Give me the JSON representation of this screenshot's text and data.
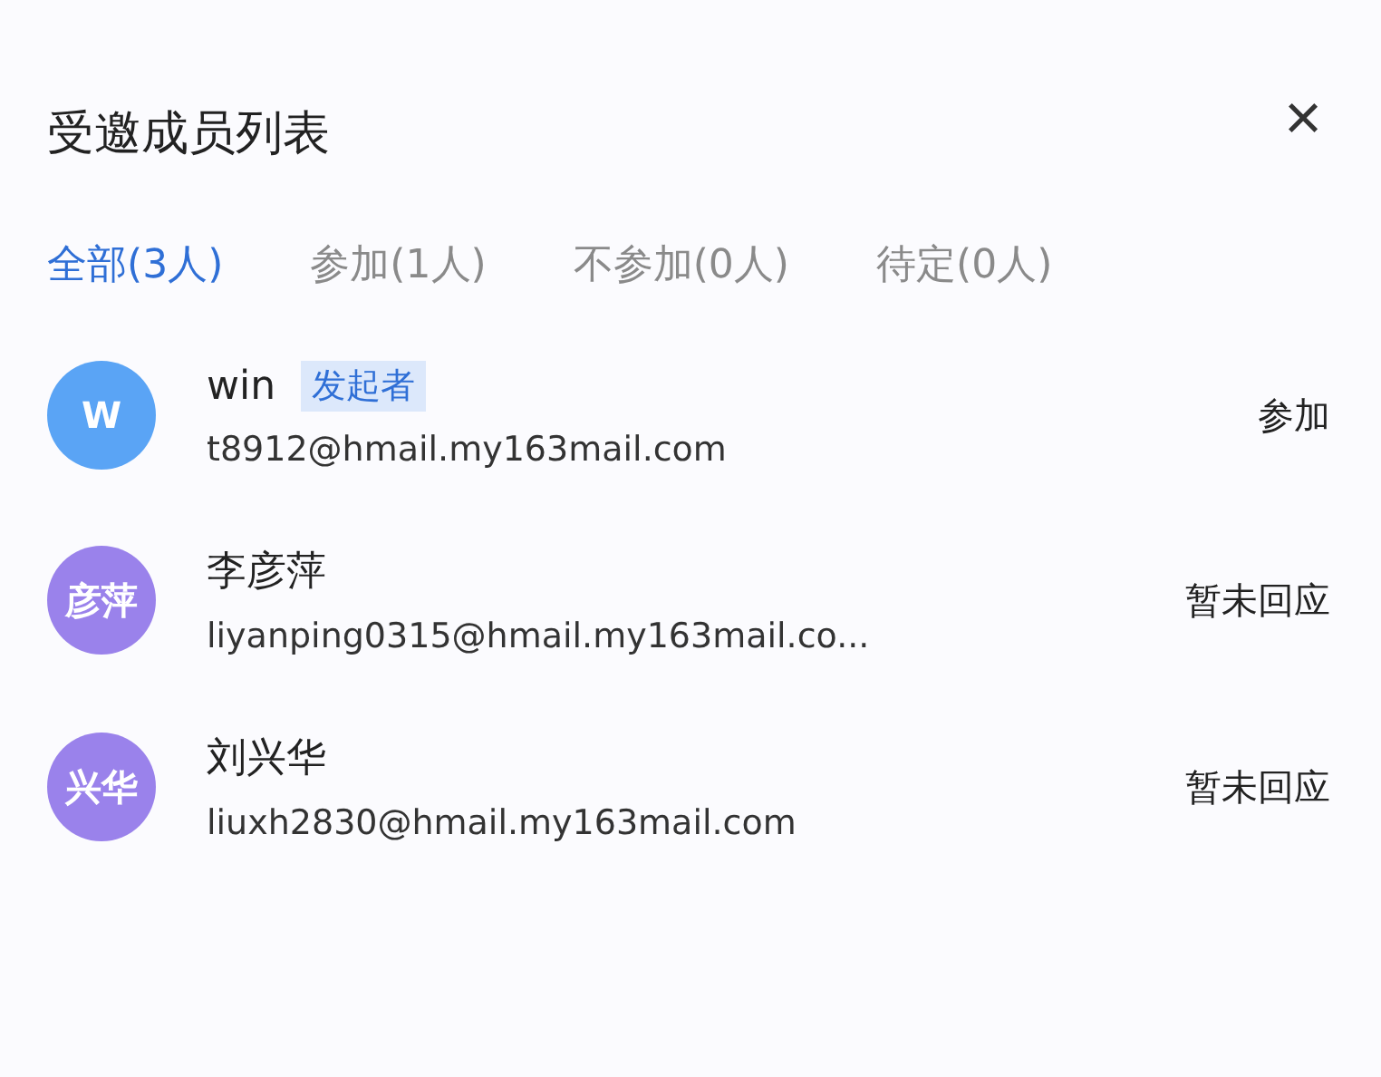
{
  "dialog": {
    "title": "受邀成员列表",
    "close": "×"
  },
  "tabs": [
    {
      "label": "全部(3人)",
      "selected": true
    },
    {
      "label": "参加(1人)",
      "selected": false
    },
    {
      "label": "不参加(0人)",
      "selected": false
    },
    {
      "label": "待定(0人)",
      "selected": false
    }
  ],
  "members": [
    {
      "avatar": "W",
      "color": "#5aa4f5",
      "name": "win",
      "badge": "发起者",
      "email": "t8912@hmail.my163mail.com",
      "status": "参加"
    },
    {
      "avatar": "彦萍",
      "color": "#9a82eb",
      "name": "李彦萍",
      "email": "liyanping0315@hmail.my163mail.co...",
      "status": "暂未回应"
    },
    {
      "avatar": "兴华",
      "color": "#9a82eb",
      "name": "刘兴华",
      "email": "liuxh2830@hmail.my163mail.com",
      "status": "暂未回应"
    }
  ]
}
